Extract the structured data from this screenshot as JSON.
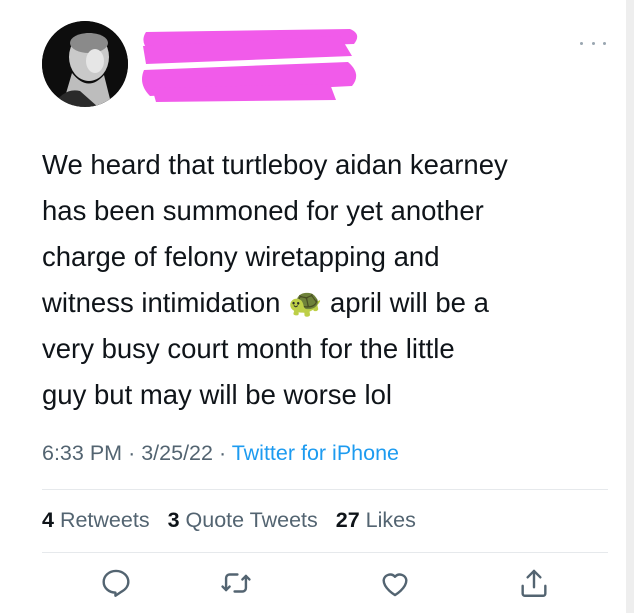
{
  "tweet": {
    "text": "We heard that turtleboy aidan kearney\nhas been summoned for yet another\ncharge of felony wiretapping and\nwitness intimidation 🐢 april will be a\nvery busy court month for the little\nguy but may will be worse lol",
    "time": "6:33 PM",
    "date": "3/25/22",
    "separator": "·",
    "source": "Twitter for iPhone"
  },
  "stats": {
    "retweets_count": "4",
    "retweets_label": "Retweets",
    "quotes_count": "3",
    "quotes_label": "Quote Tweets",
    "likes_count": "27",
    "likes_label": "Likes"
  },
  "icons": {
    "more": "more-icon",
    "reply": "reply-icon",
    "retweet": "retweet-icon",
    "like": "heart-icon",
    "share": "share-icon"
  },
  "colors": {
    "text": "#0f1419",
    "secondary": "#536471",
    "link": "#1d9bf0",
    "redaction": "#f15bea"
  }
}
